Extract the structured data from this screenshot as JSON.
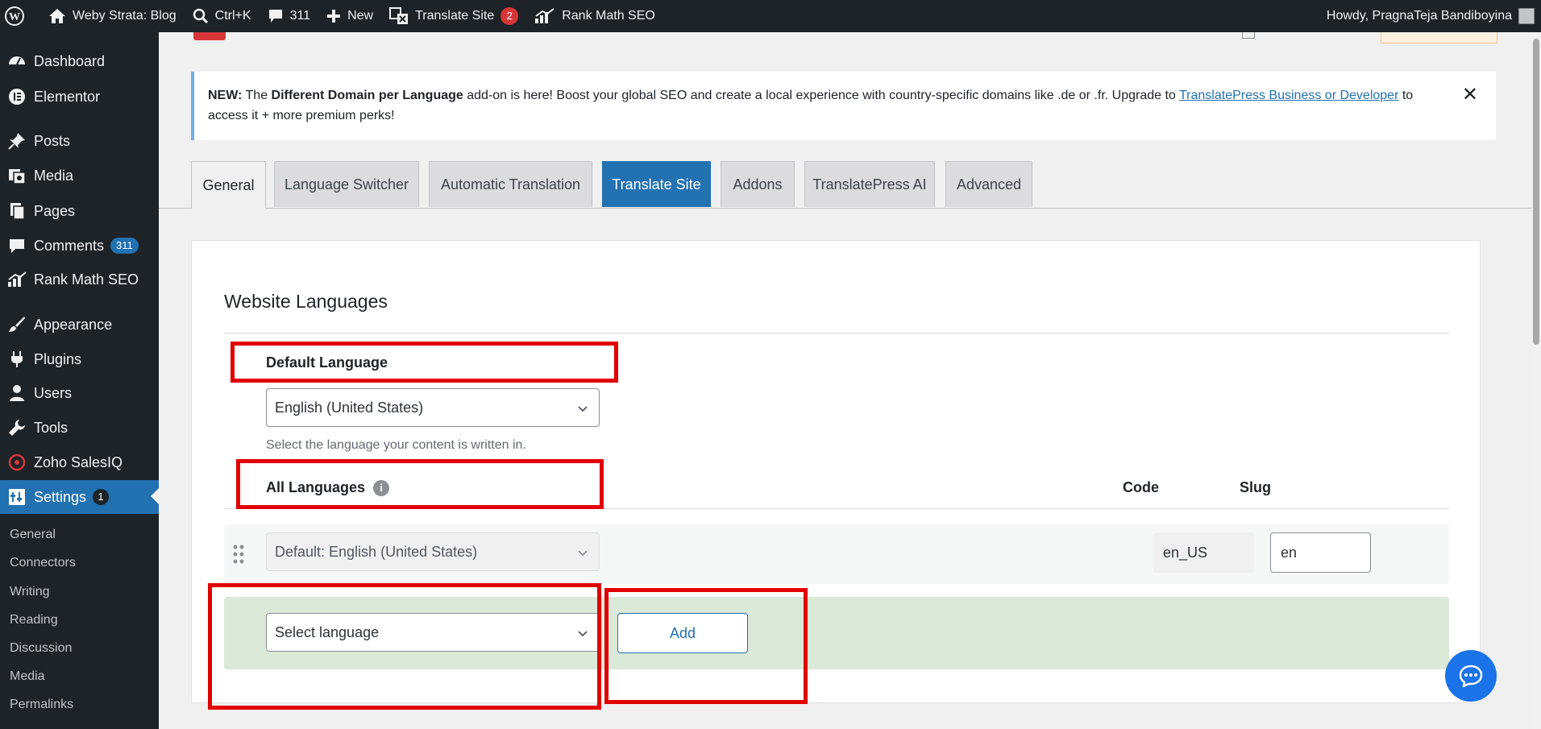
{
  "adminbar": {
    "site_name": "Weby Strata: Blog",
    "search_shortcut": "Ctrl+K",
    "comments_count": "311",
    "new_label": "New",
    "translate_label": "Translate Site",
    "translate_badge": "2",
    "rankmath_label": "Rank Math SEO",
    "howdy": "Howdy, PragnaTeja Bandiboyina"
  },
  "sidebar": {
    "items": [
      {
        "label": "Dashboard",
        "icon": "dashboard-icon"
      },
      {
        "label": "Elementor",
        "icon": "elementor-icon"
      },
      {
        "label": "Posts",
        "icon": "pin-icon"
      },
      {
        "label": "Media",
        "icon": "media-icon"
      },
      {
        "label": "Pages",
        "icon": "pages-icon"
      },
      {
        "label": "Comments",
        "icon": "comment-icon",
        "badge": "311"
      },
      {
        "label": "Rank Math SEO",
        "icon": "rankmath-icon"
      },
      {
        "label": "Appearance",
        "icon": "brush-icon"
      },
      {
        "label": "Plugins",
        "icon": "plug-icon"
      },
      {
        "label": "Users",
        "icon": "user-icon"
      },
      {
        "label": "Tools",
        "icon": "wrench-icon"
      },
      {
        "label": "Zoho SalesIQ",
        "icon": "zoho-icon"
      },
      {
        "label": "Settings",
        "icon": "settings-icon",
        "badge": "1"
      }
    ],
    "submenu": [
      "General",
      "Connectors",
      "Writing",
      "Reading",
      "Discussion",
      "Media",
      "Permalinks"
    ]
  },
  "notice": {
    "new": "NEW:",
    "text_1": " The ",
    "addon": "Different Domain per Language",
    "text_2": " add-on is here! Boost your global SEO and create a local experience with country-specific domains like .de or .fr. Upgrade to ",
    "link": "TranslatePress Business or Developer",
    "text_3": " to access it + more premium perks!"
  },
  "tabs": [
    "General",
    "Language Switcher",
    "Automatic Translation",
    "Translate Site",
    "Addons",
    "TranslatePress AI",
    "Advanced"
  ],
  "languages": {
    "section_title": "Website Languages",
    "default_label": "Default Language",
    "default_value": "English (United States)",
    "default_desc": "Select the language your content is written in.",
    "all_label": "All Languages",
    "info_glyph": "i",
    "code_head": "Code",
    "slug_head": "Slug",
    "row_default_value": "Default: English (United States)",
    "row_code": "en_US",
    "row_slug": "en",
    "select_placeholder": "Select language",
    "add_label": "Add"
  },
  "colors": {
    "accent": "#2271b1",
    "highlight_box": "#e00000",
    "admin_dark": "#1d2327",
    "add_row_bg": "#dbe9d8"
  }
}
